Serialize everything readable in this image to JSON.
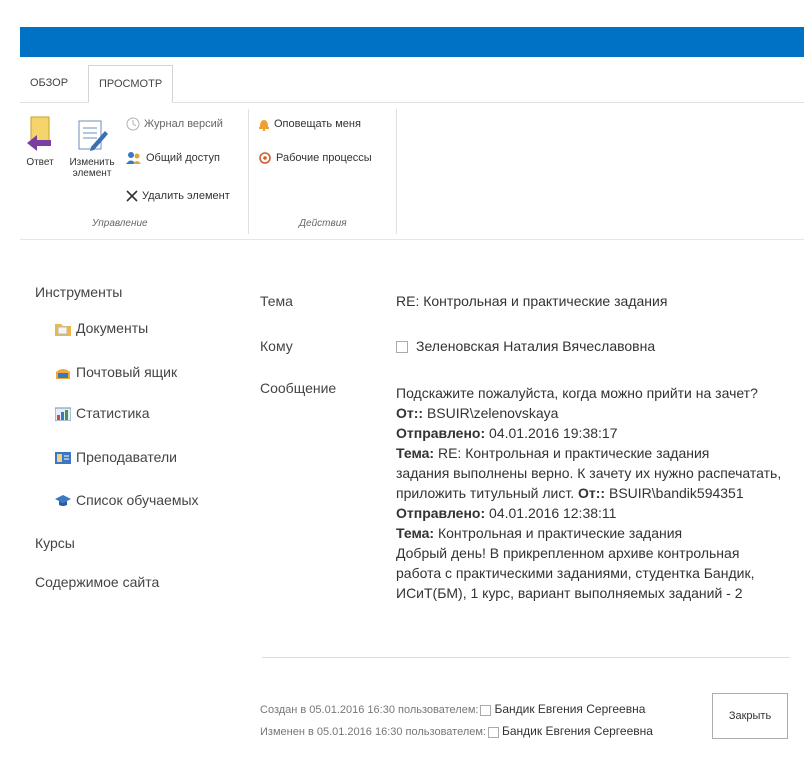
{
  "tabs": [
    "ОБЗОР",
    "ПРОСМОТР"
  ],
  "ribbon": {
    "reply_label": "Ответ",
    "edit_label_1": "Изменить",
    "edit_label_2": "элемент",
    "version_history": "Журнал версий",
    "shared_access": "Общий доступ",
    "delete_item": "Удалить элемент",
    "group_manage": "Управление",
    "alert_me": "Оповещать меня",
    "workflows": "Рабочие процессы",
    "group_actions": "Действия"
  },
  "nav": {
    "tools": "Инструменты",
    "documents": "Документы",
    "mailbox": "Почтовый ящик",
    "statistics": "Статистика",
    "teachers": "Преподаватели",
    "students": "Список обучаемых",
    "courses": "Курсы",
    "site_contents": "Содержимое сайта"
  },
  "fields": {
    "subject_label": "Тема",
    "subject_value": "RE: Контрольная и практические задания",
    "to_label": "Кому",
    "to_value": "Зеленовская Наталия Вячеславовна",
    "message_label": "Сообщение"
  },
  "message": {
    "line1": "Подскажите пожалуйста, когда можно прийти на зачет?",
    "from1_label": "От::",
    "from1_value": " BSUIR\\zelenovskaya",
    "sent1_label": "Отправлено:",
    "sent1_value": " 04.01.2016 19:38:17",
    "subj1_label": "Тема:",
    "subj1_value": " RE: Контрольная и практические задания",
    "body1a": "задания выполнены верно. К зачету их нужно распечатать,",
    "body1b": "приложить титульный лист.   ",
    "from2_label": "От::",
    "from2_value": " BSUIR\\bandik594351",
    "sent2_label": "Отправлено:",
    "sent2_value": " 04.01.2016 12:38:11",
    "subj2_label": "Тема:",
    "subj2_value": " Контрольная и практические задания",
    "body2a": "Добрый день! В прикрепленном архиве контрольная",
    "body2b": "работа с практическими заданиями, студентка Бандик,",
    "body2c": "ИСиТ(БМ), 1 курс, вариант выполняемых заданий - 2"
  },
  "footer": {
    "created": "Создан в 05.01.2016 16:30 пользователем:",
    "created_by": "Бандик Евгения Сергеевна",
    "modified": "Изменен в 05.01.2016 16:30 пользователем:",
    "modified_by": "Бандик Евгения Сергеевна",
    "close": "Закрыть"
  },
  "colors": {
    "accent": "#0072c6"
  }
}
